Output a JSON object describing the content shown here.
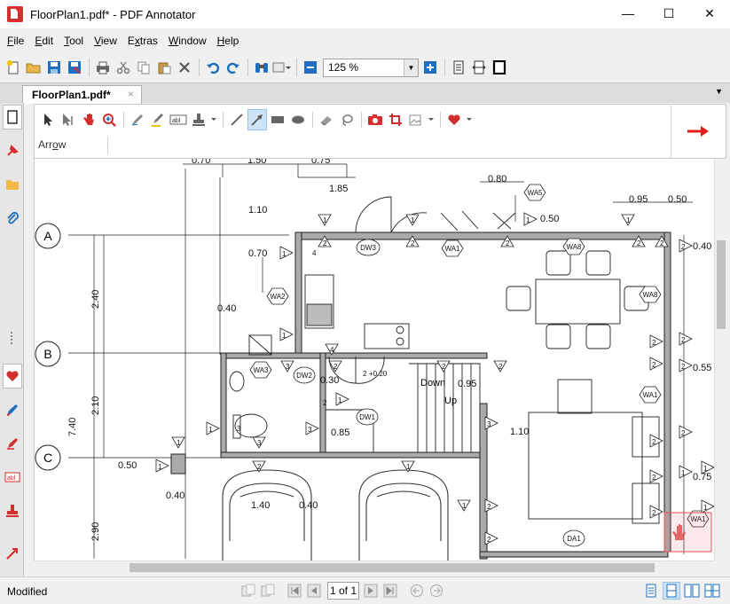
{
  "window": {
    "title": "FloorPlan1.pdf* - PDF Annotator",
    "minimize": "—",
    "maximize": "☐",
    "close": "✕"
  },
  "menu": {
    "items": [
      {
        "pre": "",
        "key": "F",
        "post": "ile"
      },
      {
        "pre": "",
        "key": "E",
        "post": "dit"
      },
      {
        "pre": "",
        "key": "T",
        "post": "ool"
      },
      {
        "pre": "",
        "key": "V",
        "post": "iew"
      },
      {
        "pre": "E",
        "key": "x",
        "post": "tras"
      },
      {
        "pre": "",
        "key": "W",
        "post": "indow"
      },
      {
        "pre": "",
        "key": "H",
        "post": "elp"
      }
    ]
  },
  "toolbar": {
    "zoom_value": "125 %"
  },
  "tabs": {
    "active_label": "FloorPlan1.pdf*",
    "close_glyph": "×",
    "menu_glyph": "▼"
  },
  "annotation": {
    "current_tool": "Arrow",
    "current_tool_pre": "Arr",
    "current_tool_key": "o",
    "current_tool_post": "w"
  },
  "plan": {
    "grid_labels": [
      "A",
      "B",
      "C"
    ],
    "dimensions": [
      "0.70",
      "1.50",
      "0.75",
      "1.85",
      "0.80",
      "0.95",
      "0.50",
      "1.10",
      "0.50",
      "0.40",
      "0.70",
      "2.40",
      "0.40",
      "0.55",
      "0.30",
      "0.95",
      "7.40",
      "2.10",
      "0.85",
      "1.10",
      "0.50",
      "0.40",
      "0.75",
      "1.40",
      "0.40",
      "2.90",
      "+0.20"
    ],
    "tags": [
      "WA5",
      "DW3",
      "WA1",
      "WA8",
      "WA2",
      "WA8",
      "WA3",
      "DW2",
      "DW1",
      "WA1",
      "WA1",
      "DA1"
    ],
    "labels": [
      "Down",
      "Up"
    ],
    "numbers": [
      "1",
      "2",
      "3",
      "4"
    ]
  },
  "status": {
    "text": "Modified",
    "page_display": "1 of 1"
  },
  "colors": {
    "accent_red": "#d32f2f",
    "accent_blue": "#1e6fbf",
    "selection": "#cde4f7"
  }
}
